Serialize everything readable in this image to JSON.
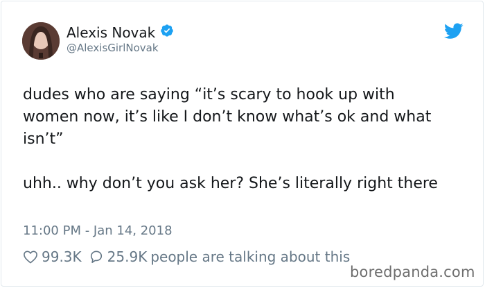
{
  "author": {
    "name": "Alexis Novak",
    "handle": "@AlexisGirlNovak",
    "verified": true
  },
  "tweet": {
    "paragraphs": [
      "dudes who are saying “it’s scary to hook up with women now, it’s like I don’t know what’s ok and what isn’t”",
      "uhh.. why don’t you ask her? She’s literally right there"
    ],
    "timestamp": "11:00 PM - Jan 14, 2018"
  },
  "stats": {
    "likes": "99.3K",
    "replies": "25.9K",
    "talking_label": "people are talking about this"
  },
  "watermark": "boredpanda.com",
  "icons": {
    "verified": "verified-badge-icon",
    "brand": "twitter-bird-icon",
    "like": "heart-icon",
    "reply": "speech-bubble-icon"
  },
  "colors": {
    "twitter_blue": "#1da1f2",
    "secondary_text": "#657786",
    "primary_text": "#14171a"
  }
}
